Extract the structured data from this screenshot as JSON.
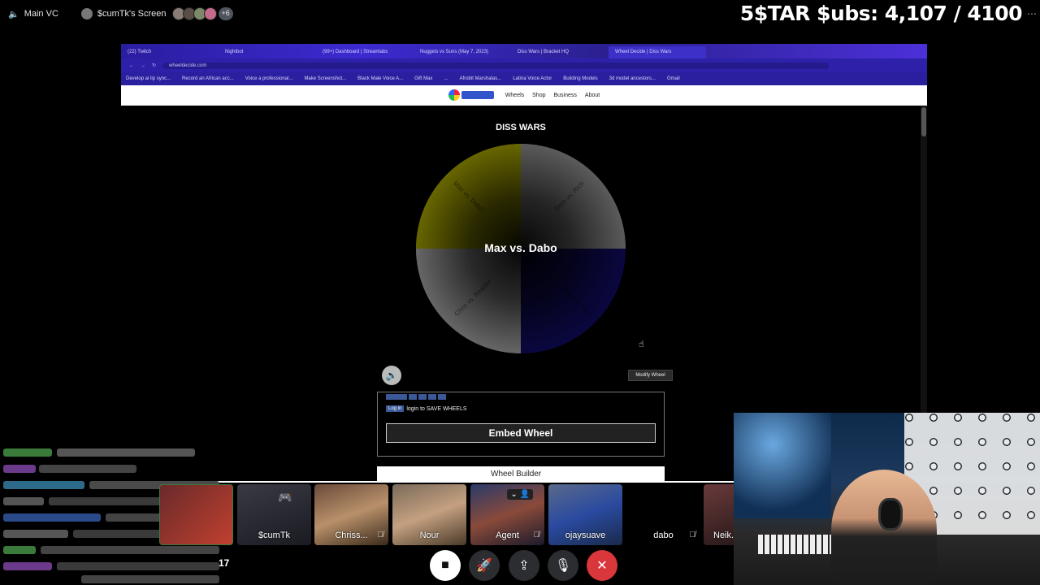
{
  "topbar": {
    "channel": "Main VC",
    "screen_owner": "$cumTk's Screen",
    "extra_viewers": "+6",
    "subs_counter": "5$TAR $ubs: 4,107 / 4100"
  },
  "browser": {
    "tabs": [
      "(22) Twitch",
      "Nightbot",
      "(99+) Dashboard | Streamlabs",
      "Nuggets vs Suns (May 7, 2023)",
      "Diss Wars | Bracket HQ",
      "Wheel Decide | Diss Wars"
    ],
    "url": "wheeldecide.com",
    "bookmarks": [
      "Develop ai lip sync...",
      "Record an African acc...",
      "Voice a professional...",
      "Make Screenshot...",
      "Black Male Voice A...",
      "Gift Max",
      "...",
      "Afrobit Marshalas...",
      "Latina Voice Actor",
      "Building Models",
      "3d model ancestors...",
      "Gmail"
    ],
    "nav": [
      "Wheels",
      "Shop",
      "Business",
      "About"
    ]
  },
  "wheel": {
    "title": "DISS WARS",
    "current_result": "Max vs. Dabo",
    "segments": [
      "Max vs. Dabo",
      "Dom vs. Rich",
      "Rich vs. Nour",
      "Chris vs. Beastie"
    ],
    "segment_colors": [
      "#8c8a00",
      "#7b7b7b",
      "#0e0a57",
      "#8a8a8a"
    ],
    "modify_label": "Modify Wheel",
    "social_follow": "Follow",
    "login_button": "Log in",
    "login_text": "login to SAVE WHEELS",
    "embed_label": "Embed Wheel",
    "next_panel": "Wheel Builder"
  },
  "call": {
    "participants": [
      {
        "name": "",
        "style": "chat-blur"
      },
      {
        "name": "$cumTk",
        "style": "gamer"
      },
      {
        "name": "Chriss...",
        "style": "duo",
        "muted": true
      },
      {
        "name": "Nour",
        "style": "face"
      },
      {
        "name": "Agent",
        "style": "cap",
        "muted": true
      },
      {
        "name": "ojaysuave",
        "style": "blue"
      },
      {
        "name": "dabo",
        "style": "dark",
        "muted": true
      },
      {
        "name": "Neik...",
        "style": "face2"
      }
    ],
    "count": "17"
  }
}
